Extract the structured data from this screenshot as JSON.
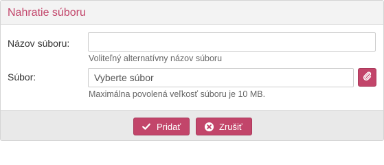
{
  "dialog": {
    "title": "Nahratie súboru"
  },
  "form": {
    "name_label": "Názov súboru:",
    "name_value": "",
    "name_help": "Voliteľný alternatívny názov súboru",
    "file_label": "Súbor:",
    "file_placeholder": "Vyberte súbor",
    "file_help": "Maximálna povolená veľkosť súboru je 10 MB.",
    "attach_icon": "paperclip-icon"
  },
  "footer": {
    "add_label": "Pridať",
    "add_icon": "checkmark-icon",
    "cancel_label": "Zrušiť",
    "cancel_icon": "close-circle-icon"
  },
  "colors": {
    "accent": "#c2456a",
    "header_bg": "#f3f3f3",
    "footer_bg": "#e9e9e9"
  }
}
